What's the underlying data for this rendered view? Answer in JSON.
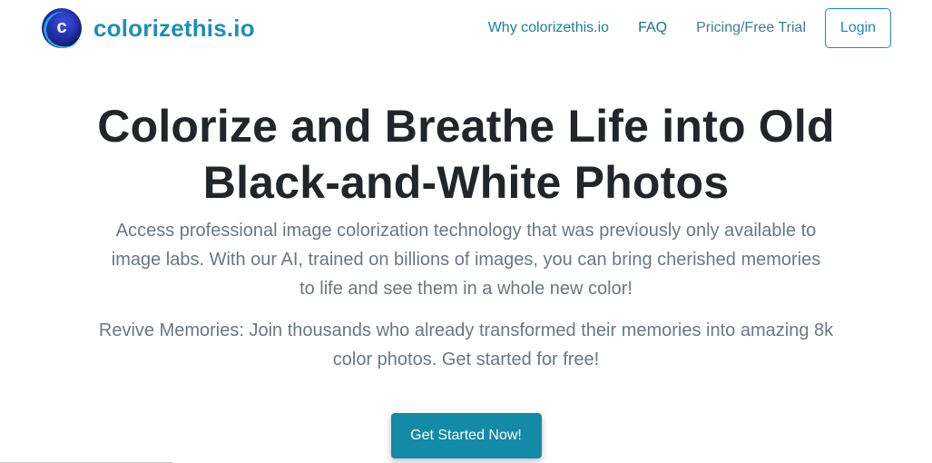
{
  "navbar": {
    "logo_letter": "c",
    "brand_name": "colorizethis.io",
    "links": [
      {
        "label": "Why colorizethis.io"
      },
      {
        "label": "FAQ"
      },
      {
        "label": "Pricing/Free Trial"
      }
    ],
    "login_label": "Login"
  },
  "hero": {
    "title_line1": "Colorize and Breathe Life into Old",
    "title_line2": "Black-and-White Photos",
    "description": "Access professional image colorization technology that was previously only available to image labs. With our AI, trained on billions of images, you can bring cherished memories to life and see them in a whole new color!",
    "subtext": "Revive Memories: Join thousands who already transformed their memories into amazing 8k color photos. Get started for free!",
    "cta_label": "Get Started Now!"
  },
  "colors": {
    "brand": "#1d8fb5",
    "cta": "#138aa6",
    "title": "#222529",
    "body_text": "#6b7782"
  }
}
